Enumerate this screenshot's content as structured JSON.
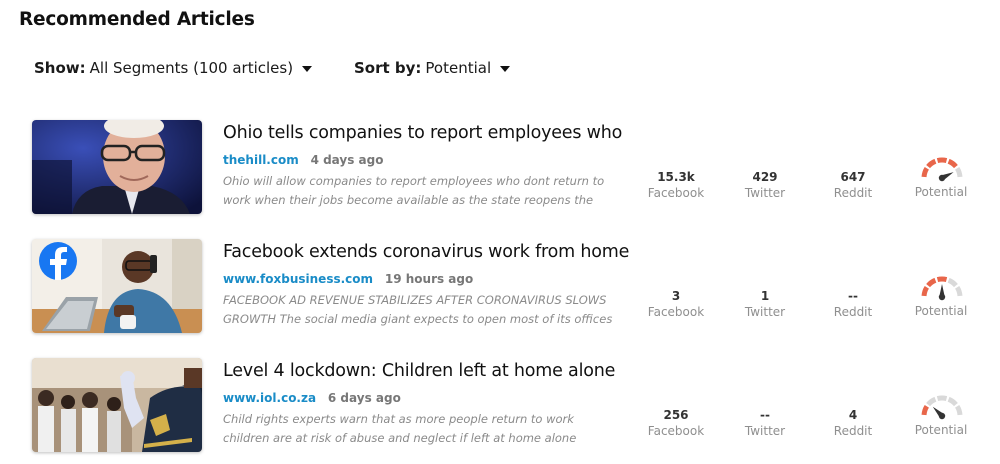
{
  "page": {
    "title": "Recommended Articles"
  },
  "filters": {
    "show": {
      "label": "Show:",
      "value": "All Segments (100 articles)"
    },
    "sort": {
      "label": "Sort by:",
      "value": "Potential"
    }
  },
  "stat_labels": {
    "facebook": "Facebook",
    "twitter": "Twitter",
    "reddit": "Reddit",
    "potential": "Potential"
  },
  "colors": {
    "link": "#1a8cc7",
    "gauge_active": "#e8664a",
    "gauge_inactive": "#d9d9d9",
    "needle": "#333333"
  },
  "articles": [
    {
      "title": "Ohio tells companies to report employees who",
      "source": "thehill.com",
      "age": "4 days ago",
      "description": "Ohio will allow companies to report employees who dont return to work when their jobs become available as the state reopens the state",
      "facebook": "15.3k",
      "twitter": "429",
      "reddit": "647",
      "potential_level": 0.85,
      "thumbnail_icon": "news-photo-man-glasses"
    },
    {
      "title": "Facebook extends coronavirus work from home",
      "source": "www.foxbusiness.com",
      "age": "19 hours ago",
      "description": "FACEBOOK AD REVENUE STABILIZES AFTER CORONAVIRUS SLOWS GROWTH The social media giant expects to open most of its offices on",
      "facebook": "3",
      "twitter": "1",
      "reddit": "--",
      "potential_level": 0.5,
      "thumbnail_icon": "facebook-logo-office-photo"
    },
    {
      "title": "Level 4 lockdown: Children left at home alone",
      "source": "www.iol.co.za",
      "age": "6 days ago",
      "description": "Child rights experts warn that as more people return to work children are at risk of abuse and neglect if left at home alone",
      "facebook": "256",
      "twitter": "--",
      "reddit": "4",
      "potential_level": 0.25,
      "thumbnail_icon": "police-officer-photo"
    }
  ]
}
